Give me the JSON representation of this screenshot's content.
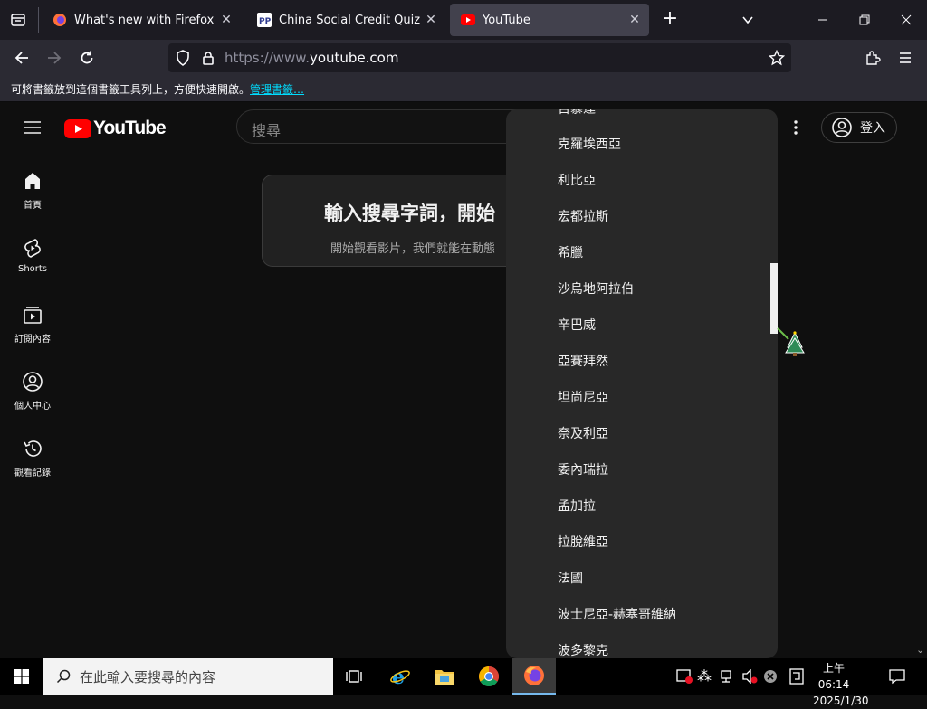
{
  "browser": {
    "tabs": [
      {
        "title": "What's new with Firefox",
        "active": false
      },
      {
        "title": "China Social Credit Quiz - Que",
        "active": false
      },
      {
        "title": "YouTube",
        "active": true
      }
    ],
    "new_tab_label": "+",
    "url_prefix": "https://www.",
    "url_domain": "youtube.com",
    "bookmark_bar_text": "可將書籤放到這個書籤工具列上，方便快速開啟。",
    "bookmark_bar_link": "管理書籤…"
  },
  "youtube": {
    "logo_text": "YouTube",
    "search_placeholder": "搜尋",
    "sign_in": "登入",
    "guide": [
      {
        "label": "首頁",
        "icon": "home-icon"
      },
      {
        "label": "Shorts",
        "icon": "shorts-icon"
      },
      {
        "label": "訂閱內容",
        "icon": "subscriptions-icon"
      },
      {
        "label": "個人中心",
        "icon": "you-icon"
      },
      {
        "label": "觀看記錄",
        "icon": "history-icon"
      }
    ],
    "empty_title": "輸入搜尋字詞，開始",
    "empty_subtitle": "開始觀看影片，我們就能在動態"
  },
  "dropdown": {
    "partial_top_item": "百慕達",
    "items": [
      "克羅埃西亞",
      "利比亞",
      "宏都拉斯",
      "希臘",
      "沙烏地阿拉伯",
      "辛巴威",
      "亞賽拜然",
      "坦尚尼亞",
      "奈及利亞",
      "委內瑞拉",
      "孟加拉",
      "拉脫維亞",
      "法國",
      "波士尼亞-赫塞哥維納",
      "波多黎克"
    ]
  },
  "taskbar": {
    "search_placeholder": "在此輸入要搜尋的內容",
    "time": "上午 06:14",
    "date": "2025/1/30"
  },
  "colors": {
    "youtube_red": "#ff0000",
    "firefox_bg": "#1c1b22",
    "dropdown_bg": "#282828"
  }
}
